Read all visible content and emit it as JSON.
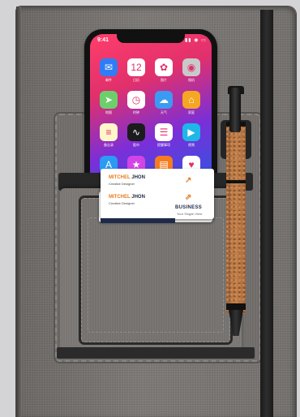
{
  "phone": {
    "time": "9:41",
    "status_icons": "▮▮ ◉ ▭",
    "apps": [
      {
        "icon": "mail-icon",
        "glyph": "✉",
        "color": "#2f7df6",
        "label": "邮件"
      },
      {
        "icon": "calendar-icon",
        "glyph": "12",
        "color": "#ffffff",
        "label": "日历"
      },
      {
        "icon": "photos-icon",
        "glyph": "✿",
        "color": "#ffffff",
        "label": "照片"
      },
      {
        "icon": "camera-icon",
        "glyph": "◉",
        "color": "#c9c9c9",
        "label": "相机"
      },
      {
        "icon": "maps-icon",
        "glyph": "➤",
        "color": "#6ccf6b",
        "label": "地图"
      },
      {
        "icon": "clock-icon",
        "glyph": "◷",
        "color": "#ffffff",
        "label": "时钟"
      },
      {
        "icon": "weather-icon",
        "glyph": "☁",
        "color": "#3b9bf2",
        "label": "天气"
      },
      {
        "icon": "home-icon",
        "glyph": "⌂",
        "color": "#f5a623",
        "label": "家庭"
      },
      {
        "icon": "notes-icon",
        "glyph": "≡",
        "color": "#fff6c9",
        "label": "备忘录"
      },
      {
        "icon": "stocks-icon",
        "glyph": "∿",
        "color": "#1c1c1e",
        "label": "股市"
      },
      {
        "icon": "reminders-icon",
        "glyph": "☰",
        "color": "#ffffff",
        "label": "提醒事项"
      },
      {
        "icon": "videos-icon",
        "glyph": "▶",
        "color": "#1fb6e8",
        "label": "视频"
      },
      {
        "icon": "appstore-icon",
        "glyph": "A",
        "color": "#2b9af3",
        "label": ""
      },
      {
        "icon": "itunes-icon",
        "glyph": "★",
        "color": "#d244e6",
        "label": ""
      },
      {
        "icon": "books-icon",
        "glyph": "▤",
        "color": "#f57c1f",
        "label": ""
      },
      {
        "icon": "health-icon",
        "glyph": "♥",
        "color": "#ffffff",
        "label": ""
      }
    ]
  },
  "card_front": {
    "first": "MITCHEL",
    "last": "JHON",
    "role": "Creative Designer"
  },
  "card_back": {
    "first": "MITCHEL",
    "last": "JHON",
    "role": "Creative Designer",
    "company": "BUSINESS",
    "slogan": "Your Slogan Here"
  }
}
